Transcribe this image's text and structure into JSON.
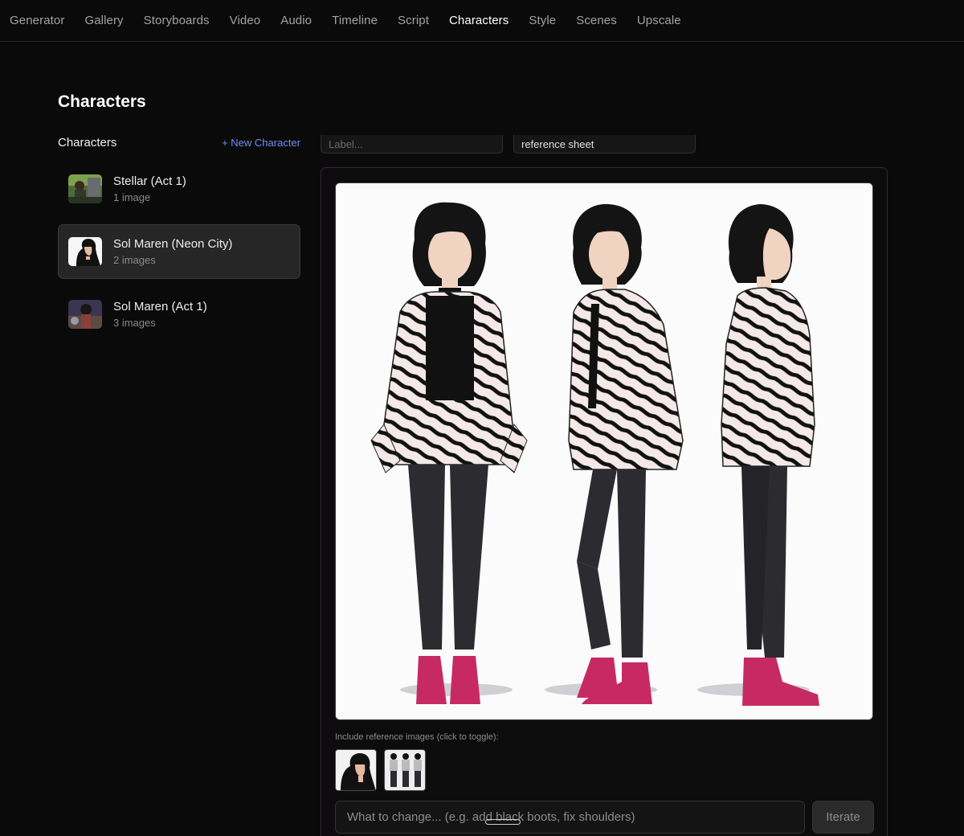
{
  "nav": {
    "tabs": [
      {
        "label": "Generator"
      },
      {
        "label": "Gallery"
      },
      {
        "label": "Storyboards"
      },
      {
        "label": "Video"
      },
      {
        "label": "Audio"
      },
      {
        "label": "Timeline"
      },
      {
        "label": "Script"
      },
      {
        "label": "Characters"
      },
      {
        "label": "Style"
      },
      {
        "label": "Scenes"
      },
      {
        "label": "Upscale"
      }
    ],
    "active": "Characters"
  },
  "page": {
    "title": "Characters"
  },
  "sidebar": {
    "heading": "Characters",
    "new_button": "+ New Character",
    "items": [
      {
        "name": "Stellar (Act 1)",
        "count": "1 image",
        "thumb_icon": "stellar-portrait",
        "selected": false
      },
      {
        "name": "Sol Maren (Neon City)",
        "count": "2 images",
        "thumb_icon": "sol-maren-profile",
        "selected": true
      },
      {
        "name": "Sol Maren (Act 1)",
        "count": "3 images",
        "thumb_icon": "sol-maren-act1-portrait",
        "selected": false
      }
    ]
  },
  "editor": {
    "label_placeholder": "Label...",
    "label_value": "",
    "tag_value": "reference sheet",
    "ref_label": "Include reference images (click to toggle):",
    "ref_images": [
      {
        "icon": "profile-thumb"
      },
      {
        "icon": "turnaround-thumb"
      }
    ],
    "iterate_placeholder": "What to change... (e.g. add black boots, fix shoulders)",
    "iterate_button": "Iterate"
  },
  "colors": {
    "background": "#0a0a0a",
    "accent_link": "#6f8ff0",
    "panel_border": "#3a1f40",
    "shoes": "#c72a63"
  }
}
